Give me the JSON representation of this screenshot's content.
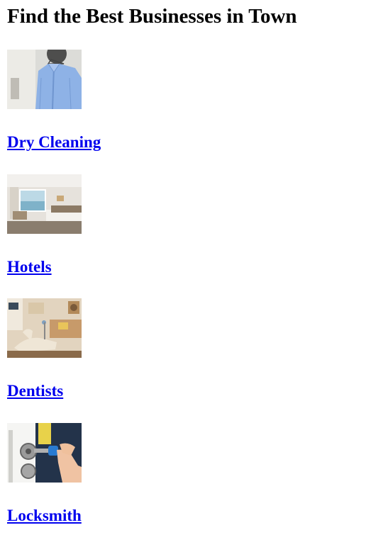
{
  "page": {
    "title": "Find the Best Businesses in Town"
  },
  "categories": [
    {
      "label": "Dry Cleaning",
      "image_icon": "dry-cleaning-photo"
    },
    {
      "label": "Hotels",
      "image_icon": "hotel-room-photo"
    },
    {
      "label": "Dentists",
      "image_icon": "dental-office-photo"
    },
    {
      "label": "Locksmith",
      "image_icon": "locksmith-photo"
    }
  ],
  "colors": {
    "link": "#0000EE",
    "text": "#000000",
    "background": "#FFFFFF"
  }
}
